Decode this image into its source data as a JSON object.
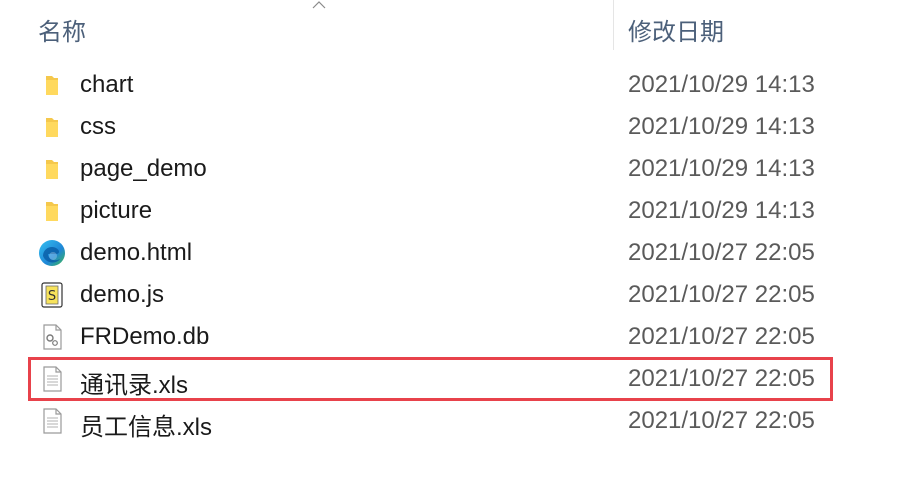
{
  "header": {
    "name_label": "名称",
    "date_label": "修改日期"
  },
  "files": [
    {
      "name": "chart",
      "date": "2021/10/29 14:13",
      "icon": "folder-icon"
    },
    {
      "name": "css",
      "date": "2021/10/29 14:13",
      "icon": "folder-icon"
    },
    {
      "name": "page_demo",
      "date": "2021/10/29 14:13",
      "icon": "folder-icon"
    },
    {
      "name": "picture",
      "date": "2021/10/29 14:13",
      "icon": "folder-icon"
    },
    {
      "name": "demo.html",
      "date": "2021/10/27 22:05",
      "icon": "edge-browser-icon"
    },
    {
      "name": "demo.js",
      "date": "2021/10/27 22:05",
      "icon": "javascript-file-icon"
    },
    {
      "name": "FRDemo.db",
      "date": "2021/10/27 22:05",
      "icon": "database-file-icon"
    },
    {
      "name": "通讯录.xls",
      "date": "2021/10/27 22:05",
      "icon": "document-file-icon"
    },
    {
      "name": "员工信息.xls",
      "date": "2021/10/27 22:05",
      "icon": "document-file-icon"
    }
  ],
  "highlight": {
    "color": "#e8424b"
  }
}
